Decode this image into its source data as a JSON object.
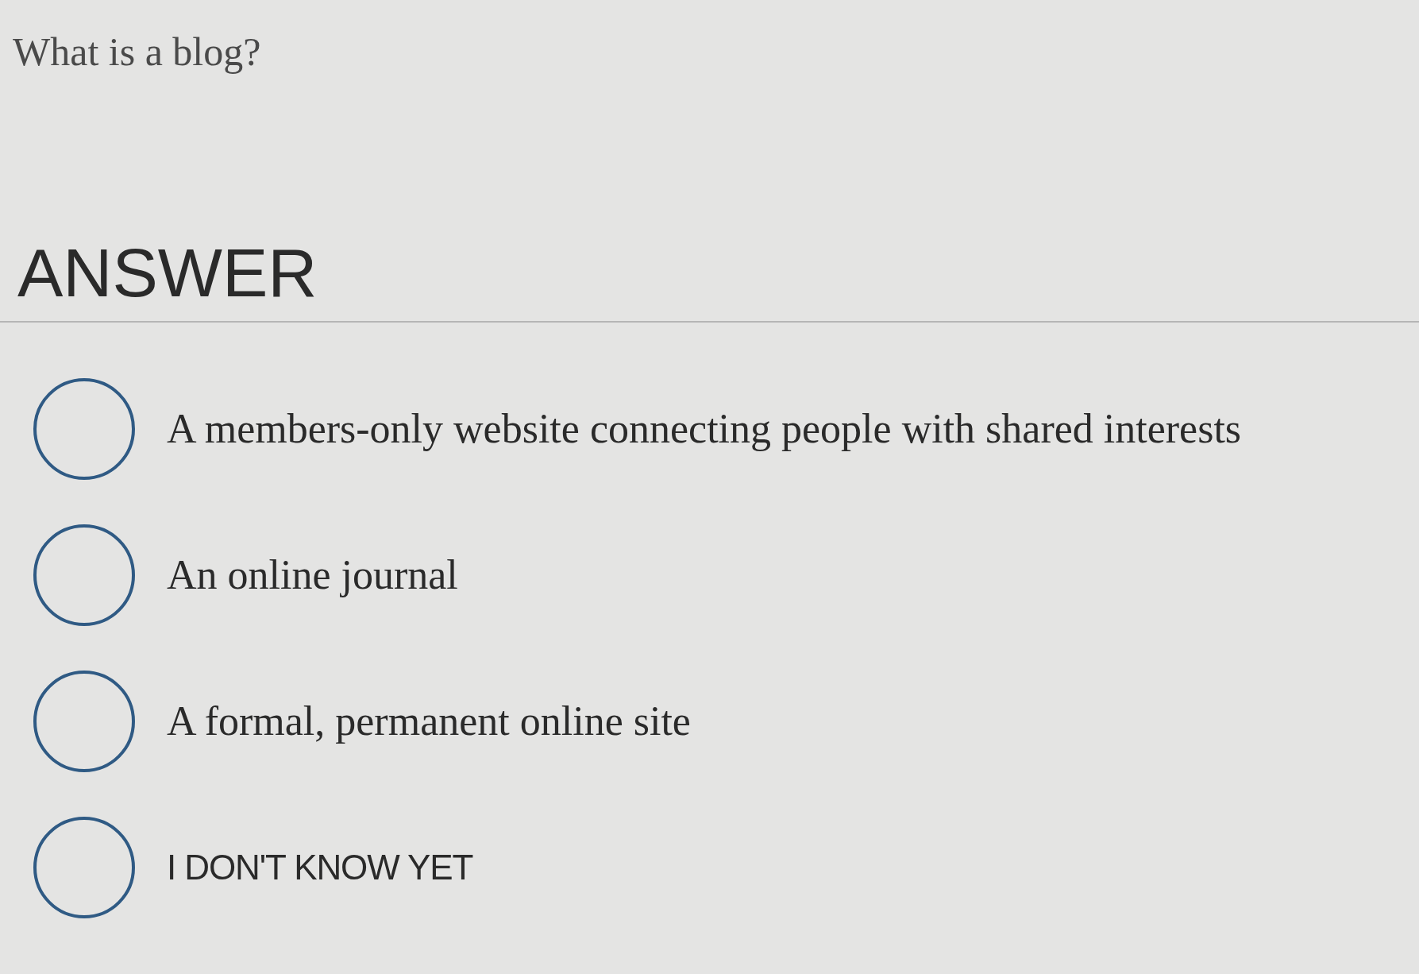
{
  "question": "What is a blog?",
  "heading": "ANSWER",
  "options": [
    {
      "label": "A members-only website connecting people with shared interests",
      "kind": "serif",
      "selected": false
    },
    {
      "label": "An online journal",
      "kind": "serif",
      "selected": false
    },
    {
      "label": "A formal, permanent online site",
      "kind": "serif",
      "selected": false
    },
    {
      "label": "I DON'T KNOW YET",
      "kind": "caps",
      "selected": false
    }
  ]
}
